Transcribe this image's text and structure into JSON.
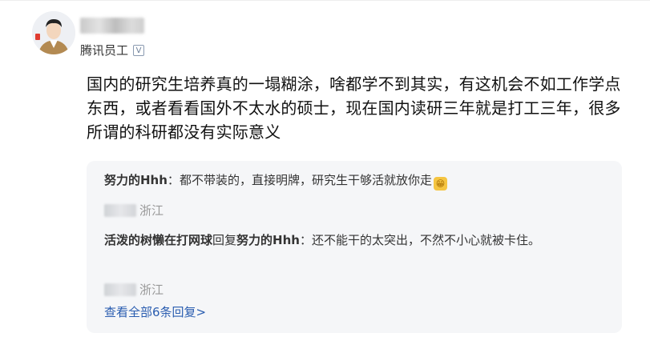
{
  "header": {
    "staff_label": "腾讯员工",
    "verified_icon": "V"
  },
  "post": {
    "text": "国内的研究生培养真的一塌糊涂，啥都学不到其实，有这机会不如工作学点东西，或者看看国外不太水的硕士，现在国内读研三年就是打工三年，很多所谓的科研都没有实际意义"
  },
  "replies": [
    {
      "author": "努力的Hhh",
      "sep": "：",
      "content": "都不带装的，直接明牌，研究生干够活就放你走",
      "emoji": "😁",
      "location": "浙江"
    },
    {
      "author": "活泼的树懒在打网球",
      "reply_word": "回复",
      "reply_to": "努力的Hhh",
      "sep": "：",
      "content": "还不能干的太突出，不然不小心就被卡住。",
      "location": "浙江"
    }
  ],
  "view_all": "查看全部6条回复>"
}
